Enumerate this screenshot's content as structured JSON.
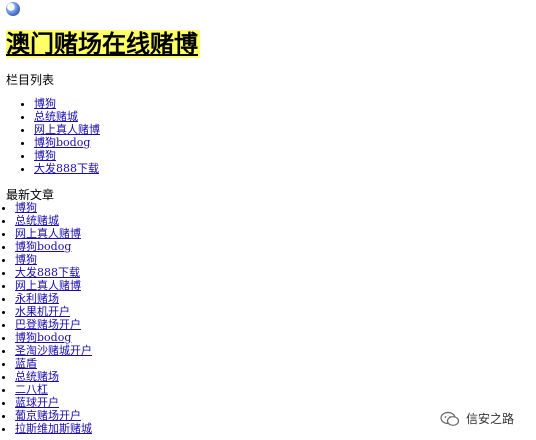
{
  "site": {
    "title": "澳门赌场在线赌博"
  },
  "categories": {
    "label": "栏目列表",
    "items": [
      "博狗",
      "总统赌城",
      "网上真人赌博",
      "博狗bodog",
      "博狗",
      "大发888下载"
    ]
  },
  "latest": {
    "label": "最新文章",
    "items": [
      "博狗",
      "总统赌城",
      "网上真人赌博",
      "博狗bodog",
      "博狗",
      "大发888下载",
      "网上真人赌博",
      "永利赌场",
      "水果机开户",
      "巴登赌场开户",
      "博狗bodog",
      "圣淘沙赌城开户",
      "蓝盾",
      "总统赌场",
      "二八杠",
      "蓝球开户",
      "葡京赌场开户",
      "拉斯维加斯赌城"
    ]
  },
  "watermark": {
    "text": "信安之路"
  }
}
